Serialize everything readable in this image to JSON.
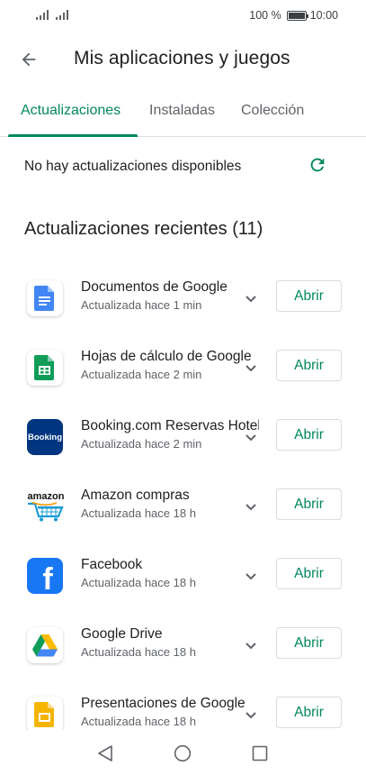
{
  "status_bar": {
    "battery_text": "100 %",
    "time": "10:00"
  },
  "header": {
    "title": "Mis aplicaciones y juegos",
    "back_icon": "arrow-back-icon"
  },
  "tabs": [
    {
      "label": "Actualizaciones",
      "active": true
    },
    {
      "label": "Instaladas",
      "active": false
    },
    {
      "label": "Colección",
      "active": false
    }
  ],
  "updates": {
    "message": "No hay actualizaciones disponibles",
    "refresh_icon": "refresh-icon"
  },
  "recent": {
    "title": "Actualizaciones recientes (11)",
    "open_label": "Abrir",
    "items": [
      {
        "name": "Documentos de Google",
        "status": "Actualizada hace 1 min",
        "icon": "google-docs-icon"
      },
      {
        "name": "Hojas de cálculo de Google",
        "status": "Actualizada hace 2 min",
        "icon": "google-sheets-icon"
      },
      {
        "name": "Booking.com Reservas Hoteles",
        "status": "Actualizada hace 2 min",
        "icon": "booking-icon",
        "icon_text": "Booking"
      },
      {
        "name": "Amazon compras",
        "status": "Actualizada hace 18 h",
        "icon": "amazon-icon",
        "icon_text": "amazon"
      },
      {
        "name": "Facebook",
        "status": "Actualizada hace 18 h",
        "icon": "facebook-icon",
        "icon_text": "f"
      },
      {
        "name": "Google Drive",
        "status": "Actualizada hace 18 h",
        "icon": "google-drive-icon"
      },
      {
        "name": "Presentaciones de Google",
        "status": "Actualizada hace 18 h",
        "icon": "google-slides-icon"
      }
    ]
  },
  "nav": {
    "back_icon": "nav-back-icon",
    "home_icon": "nav-home-icon",
    "recents_icon": "nav-recents-icon"
  },
  "colors": {
    "accent": "#01875f",
    "docs": "#4285f4",
    "sheets": "#0f9d58",
    "booking": "#003580",
    "facebook": "#1877f2",
    "slides": "#f4b400"
  }
}
